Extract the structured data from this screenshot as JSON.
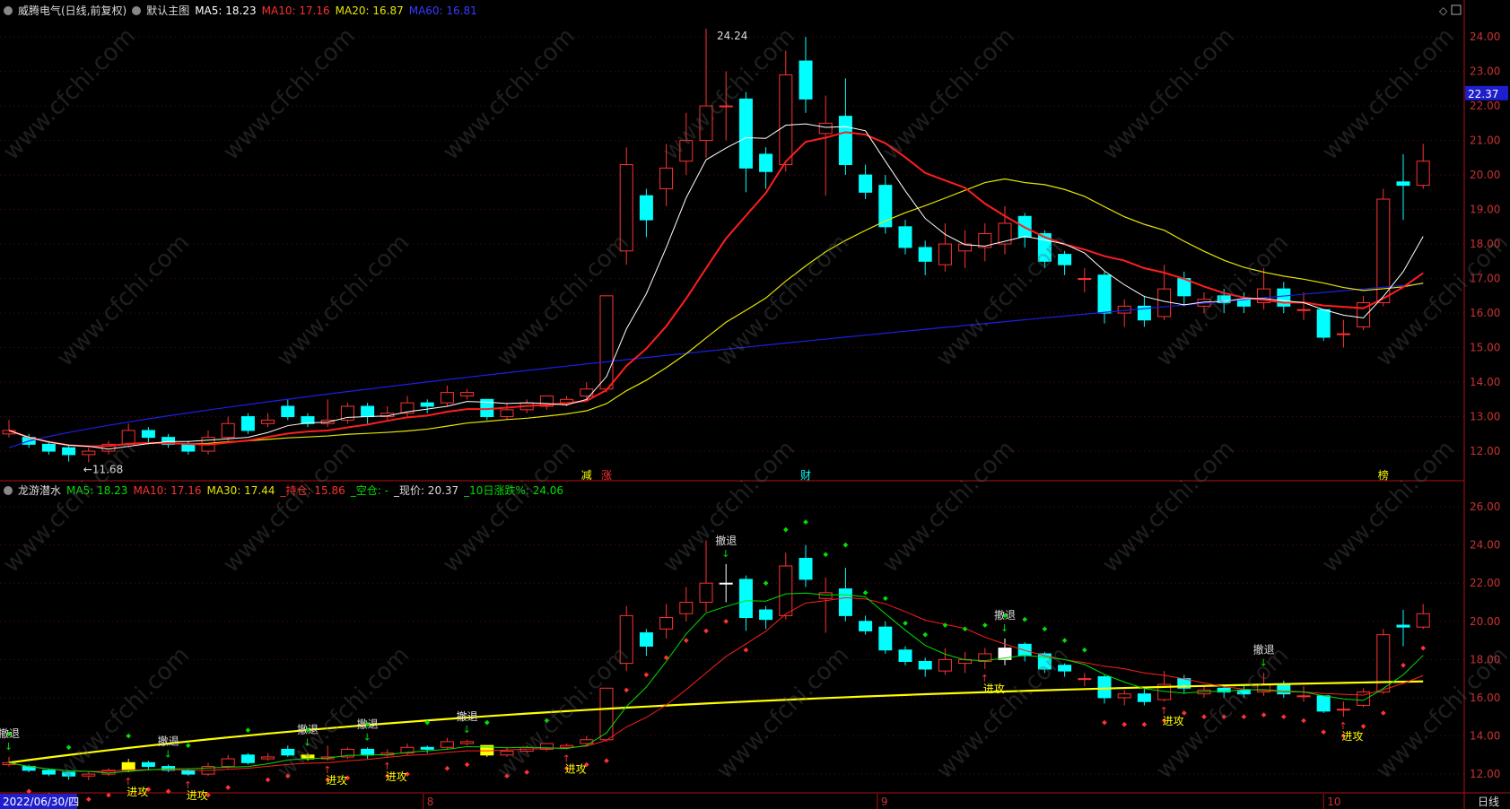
{
  "colors": {
    "up": "#ff3232",
    "down": "#00ffff",
    "ma5": "#ffffff",
    "ma10": "#ff1e1e",
    "ma20": "#e6e600",
    "ma60": "#1e1ee6",
    "axis": "#b01010",
    "grid": "#5a0a0a",
    "green": "#00e000",
    "yellow": "#ffff00",
    "white": "#ffffff"
  },
  "main_header": {
    "stock": "威腾电气(日线,前复权)",
    "template": "默认主图",
    "ma5": "MA5: 18.23",
    "ma10": "MA10: 17.16",
    "ma20": "MA20: 16.87",
    "ma60": "MA60: 16.81"
  },
  "sub_header": {
    "name": "龙游潜水",
    "ma5": "MA5: 18.23",
    "ma10": "MA10: 17.16",
    "ma30": "MA30: 17.44",
    "hold": "_持仓: 15.86",
    "empty": "_空仓: -",
    "price": "_现价: 20.37",
    "chg10": "_10日涨跌%: 24.06"
  },
  "bottom": {
    "date": "2022/06/30/四",
    "months": [
      "8",
      "9",
      "10"
    ],
    "period": "日线"
  },
  "price_tag": "22.37",
  "labels": {
    "max": "24.24",
    "min": "11.68",
    "retreat": "撤退",
    "attack": "进攻",
    "markers": [
      "减",
      "涨",
      "财",
      "榜"
    ],
    "watermark": "www.cfchi.com"
  },
  "chart_data": {
    "type": "candlestick",
    "main_yaxis": [
      12,
      13,
      14,
      15,
      16,
      17,
      18,
      19,
      20,
      21,
      22,
      23,
      24
    ],
    "sub_yaxis": [
      12,
      14,
      16,
      18,
      20,
      22,
      24,
      26
    ],
    "ylim_main": [
      11.3,
      24.6
    ],
    "ylim_sub": [
      11.3,
      26.8
    ],
    "candles": [
      [
        12.5,
        12.6,
        12.9,
        12.4
      ],
      [
        12.4,
        12.2,
        12.5,
        12.1
      ],
      [
        12.2,
        12.0,
        12.3,
        11.9
      ],
      [
        12.1,
        11.9,
        12.2,
        11.7
      ],
      [
        11.9,
        12.0,
        12.1,
        11.68
      ],
      [
        12.0,
        12.2,
        12.3,
        11.9
      ],
      [
        12.2,
        12.6,
        12.8,
        12.1
      ],
      [
        12.6,
        12.4,
        12.7,
        12.2
      ],
      [
        12.4,
        12.2,
        12.5,
        12.1
      ],
      [
        12.2,
        12.0,
        12.3,
        11.9
      ],
      [
        12.0,
        12.4,
        12.6,
        11.9
      ],
      [
        12.4,
        12.8,
        13.0,
        12.3
      ],
      [
        13.0,
        12.6,
        13.1,
        12.5
      ],
      [
        12.8,
        12.9,
        13.1,
        12.7
      ],
      [
        13.3,
        13.0,
        13.5,
        12.9
      ],
      [
        13.0,
        12.8,
        13.1,
        12.7
      ],
      [
        12.8,
        12.9,
        13.5,
        12.7
      ],
      [
        12.9,
        13.3,
        13.4,
        12.8
      ],
      [
        13.3,
        13.0,
        13.4,
        12.8
      ],
      [
        13.0,
        13.1,
        13.3,
        12.9
      ],
      [
        13.1,
        13.4,
        13.6,
        13.0
      ],
      [
        13.4,
        13.3,
        13.5,
        13.1
      ],
      [
        13.4,
        13.7,
        13.9,
        13.3
      ],
      [
        13.6,
        13.7,
        13.8,
        13.5
      ],
      [
        13.5,
        13.0,
        13.5,
        12.9
      ],
      [
        13.0,
        13.2,
        13.4,
        12.9
      ],
      [
        13.2,
        13.4,
        13.5,
        13.1
      ],
      [
        13.3,
        13.6,
        13.6,
        13.2
      ],
      [
        13.4,
        13.5,
        13.6,
        13.3
      ],
      [
        13.6,
        13.8,
        14.0,
        13.5
      ],
      [
        13.8,
        16.5,
        16.5,
        13.7
      ],
      [
        17.8,
        20.3,
        20.8,
        17.4
      ],
      [
        19.4,
        18.7,
        19.6,
        18.2
      ],
      [
        19.6,
        20.2,
        20.9,
        19.1
      ],
      [
        20.4,
        21.0,
        21.8,
        20.0
      ],
      [
        21.0,
        22.0,
        24.24,
        20.5
      ],
      [
        22.0,
        22.0,
        23.0,
        21.0
      ],
      [
        22.2,
        20.2,
        22.4,
        19.5
      ],
      [
        20.6,
        20.1,
        20.8,
        19.6
      ],
      [
        20.3,
        22.9,
        23.6,
        20.1
      ],
      [
        23.3,
        22.2,
        24.0,
        21.8
      ],
      [
        21.2,
        21.5,
        22.3,
        19.4
      ],
      [
        21.7,
        20.3,
        22.8,
        20.0
      ],
      [
        20.0,
        19.5,
        20.3,
        19.3
      ],
      [
        19.7,
        18.5,
        20.0,
        18.3
      ],
      [
        18.5,
        17.9,
        18.7,
        17.7
      ],
      [
        17.9,
        17.5,
        18.1,
        17.1
      ],
      [
        17.4,
        18.0,
        18.6,
        17.2
      ],
      [
        17.8,
        18.0,
        18.4,
        17.3
      ],
      [
        17.9,
        18.3,
        18.6,
        17.5
      ],
      [
        18.0,
        18.6,
        19.1,
        17.7
      ],
      [
        18.8,
        18.2,
        18.9,
        17.9
      ],
      [
        18.3,
        17.5,
        18.4,
        17.3
      ],
      [
        17.7,
        17.4,
        17.8,
        17.1
      ],
      [
        17.0,
        17.0,
        17.3,
        16.6
      ],
      [
        17.1,
        16.0,
        17.2,
        15.7
      ],
      [
        16.0,
        16.2,
        16.4,
        15.6
      ],
      [
        16.2,
        15.8,
        16.5,
        15.6
      ],
      [
        15.9,
        16.7,
        17.4,
        15.8
      ],
      [
        17.0,
        16.5,
        17.2,
        16.2
      ],
      [
        16.2,
        16.4,
        16.6,
        16.0
      ],
      [
        16.5,
        16.3,
        16.7,
        16.0
      ],
      [
        16.4,
        16.2,
        16.6,
        16.0
      ],
      [
        16.3,
        16.7,
        17.3,
        16.1
      ],
      [
        16.7,
        16.2,
        16.9,
        16.0
      ],
      [
        16.1,
        16.1,
        16.6,
        15.8
      ],
      [
        16.1,
        15.3,
        16.1,
        15.2
      ],
      [
        15.4,
        15.4,
        15.8,
        15.0
      ],
      [
        15.6,
        16.3,
        16.5,
        15.5
      ],
      [
        16.3,
        19.3,
        19.6,
        16.2
      ],
      [
        19.8,
        19.7,
        20.6,
        18.7
      ],
      [
        19.7,
        20.4,
        20.9,
        19.6
      ]
    ],
    "sub_markers": {
      "retreat_idx": [
        0,
        8,
        15,
        18,
        23,
        36,
        50,
        63
      ],
      "attack_idx": [
        6,
        9,
        16,
        19,
        28,
        49,
        58,
        67
      ]
    }
  }
}
